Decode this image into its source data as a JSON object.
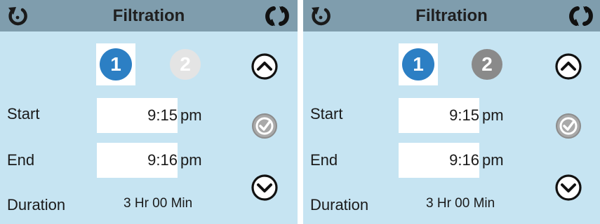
{
  "screens": [
    {
      "title": "Filtration",
      "selectors": [
        "1",
        "2"
      ],
      "active_selector": "1",
      "start_label": "Start",
      "start_time": "9:15",
      "start_ampm": "pm",
      "end_label": "End",
      "end_time": "9:16",
      "end_ampm": "pm",
      "duration_label": "Duration",
      "duration_value": "3 Hr 00 Min"
    },
    {
      "title": "Filtration",
      "selectors": [
        "1",
        "2"
      ],
      "active_selector": "1",
      "start_label": "Start",
      "start_time": "9:15",
      "start_ampm": "pm",
      "end_label": "End",
      "end_time": "9:16",
      "end_ampm": "pm",
      "duration_label": "Duration",
      "duration_value": "3 Hr 00 Min"
    }
  ],
  "icons": {
    "back": "back-arrow-icon",
    "sync": "sync-icon",
    "up": "chevron-up-icon",
    "confirm": "checkmark-icon",
    "down": "chevron-down-icon"
  },
  "colors": {
    "background": "#c6e4f2",
    "titlebar": "#7f9dad",
    "selector_active": "#2c7fc4",
    "selector_inactive_left": "#e4e4e4",
    "selector_inactive_right": "#8a8a8a",
    "confirm_disabled": "#a9a9a9"
  }
}
